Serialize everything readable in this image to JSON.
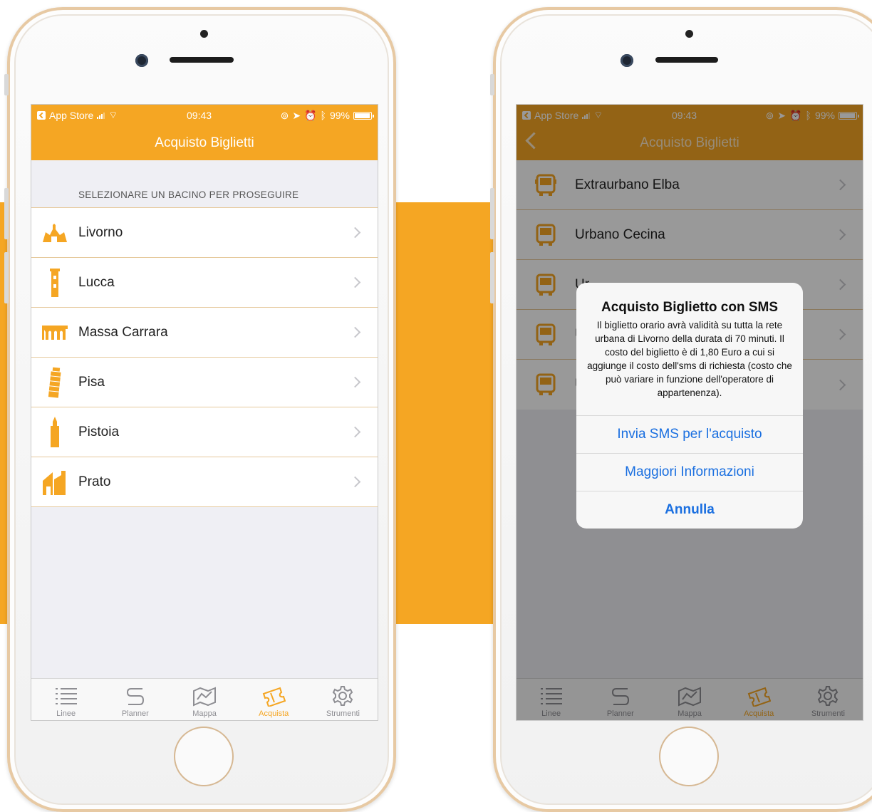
{
  "colors": {
    "accent": "#f5a623",
    "link": "#1a6fe0"
  },
  "status_bar": {
    "back_app": "App Store",
    "time": "09:43",
    "battery": "99%"
  },
  "left_screen": {
    "title": "Acquisto Biglietti",
    "section_header": "SELEZIONARE UN BACINO PER PROSEGUIRE",
    "items": [
      {
        "label": "Livorno",
        "icon": "fortress-icon"
      },
      {
        "label": "Lucca",
        "icon": "tower-icon"
      },
      {
        "label": "Massa Carrara",
        "icon": "aqueduct-icon"
      },
      {
        "label": "Pisa",
        "icon": "leaning-tower-icon"
      },
      {
        "label": "Pistoia",
        "icon": "bell-tower-icon"
      },
      {
        "label": "Prato",
        "icon": "cathedral-icon"
      }
    ]
  },
  "right_screen": {
    "title": "Acquisto Biglietti",
    "items": [
      {
        "label": "Extraurbano Elba",
        "icon": "bus-icon"
      },
      {
        "label": "Urbano Cecina",
        "icon": "bus-icon"
      },
      {
        "label": "Ur",
        "icon": "bus-icon"
      },
      {
        "label": "U",
        "icon": "bus-icon"
      },
      {
        "label": "U",
        "icon": "bus-icon"
      }
    ],
    "alert": {
      "title": "Acquisto Biglietto con SMS",
      "message": "Il biglietto orario avrà validità su tutta la rete urbana di Livorno della durata di 70 minuti. Il costo del biglietto è di 1,80 Euro a cui si aggiunge il costo dell'sms di richiesta (costo che può variare in funzione dell'operatore di appartenenza).",
      "buttons": [
        "Invia SMS per l'acquisto",
        "Maggiori Informazioni",
        "Annulla"
      ]
    }
  },
  "tabbar": {
    "tabs": [
      {
        "label": "Linee",
        "icon": "list-icon"
      },
      {
        "label": "Planner",
        "icon": "route-icon"
      },
      {
        "label": "Mappa",
        "icon": "map-icon"
      },
      {
        "label": "Acquista",
        "icon": "ticket-icon"
      },
      {
        "label": "Strumenti",
        "icon": "gear-icon"
      }
    ],
    "active": "Acquista"
  }
}
